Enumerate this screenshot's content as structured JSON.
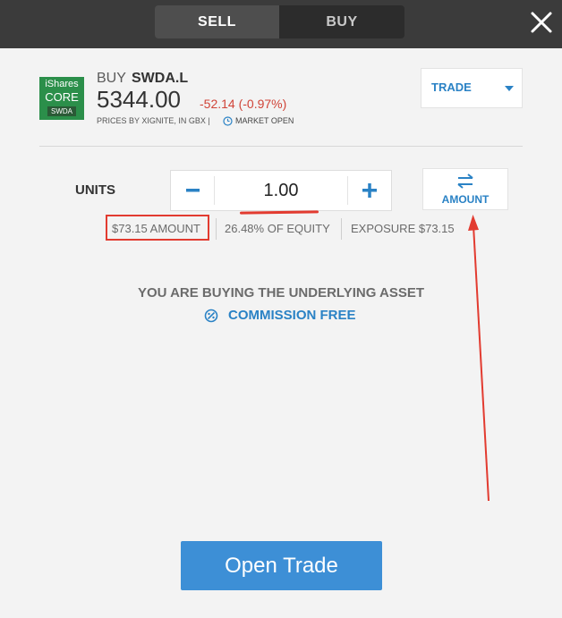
{
  "tabs": {
    "sell": "SELL",
    "buy": "BUY"
  },
  "logo": {
    "line1": "iShares",
    "line2": "CORE",
    "line3": "SWDA"
  },
  "instrument": {
    "action": "BUY",
    "symbol": "SWDA.L",
    "price": "5344.00",
    "change": "-52.14 (-0.97%)",
    "prices_source": "PRICES BY XIGNITE, IN GBX |",
    "market_status": "MARKET OPEN"
  },
  "trade_dropdown": {
    "label": "TRADE"
  },
  "units": {
    "label": "UNITS",
    "value": "1.00"
  },
  "amount_toggle": {
    "label": "AMOUNT"
  },
  "info": {
    "amount": "$73.15 AMOUNT",
    "equity": "26.48% OF EQUITY",
    "exposure": "EXPOSURE $73.15"
  },
  "message": {
    "underlying": "YOU ARE BUYING THE UNDERLYING ASSET",
    "commission": "COMMISSION FREE"
  },
  "open_trade": {
    "label": "Open Trade"
  },
  "colors": {
    "accent": "#2a82c5",
    "negative": "#d04438",
    "annotation": "#e23b30",
    "button": "#3d8fd6"
  }
}
